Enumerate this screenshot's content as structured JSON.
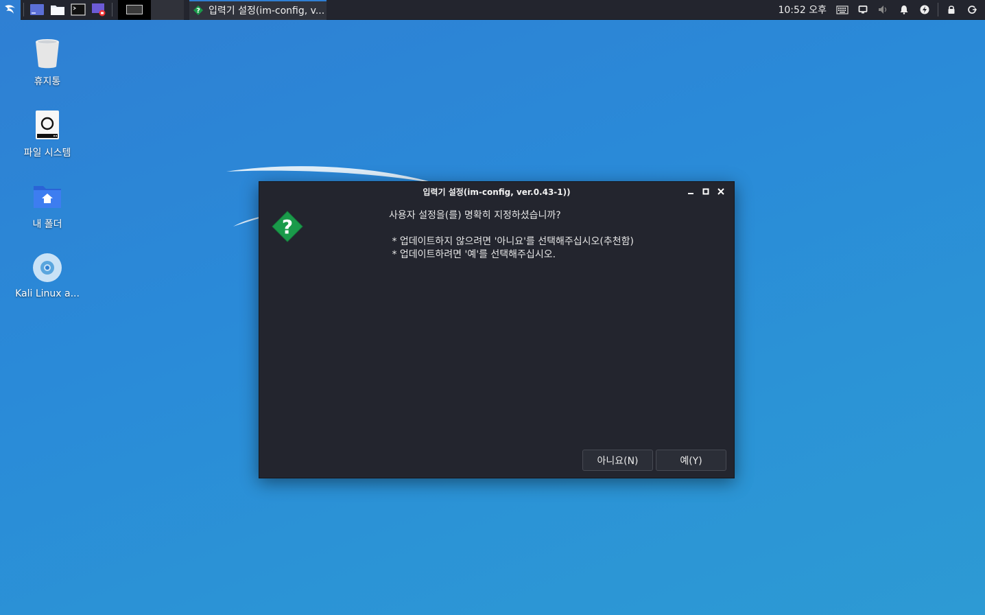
{
  "panel": {
    "task_label": "입력기 설정(im-config, v...",
    "clock": "10:52 오후"
  },
  "desktop": {
    "icons": [
      {
        "label": "휴지통",
        "icon": "trash-icon"
      },
      {
        "label": "파일 시스템",
        "icon": "drive-icon"
      },
      {
        "label": "내 폴더",
        "icon": "home-folder-icon"
      },
      {
        "label": "Kali Linux a...",
        "icon": "disc-icon"
      }
    ]
  },
  "dialog": {
    "title": "입력기 설정(im-config, ver.0.43-1))",
    "message": {
      "question": "사용자 설정을(를) 명확히 지정하셨습니까?",
      "blank": "",
      "bullet_no": " * 업데이트하지 않으려면 '아니요'를 선택해주십시오(추천함)",
      "bullet_yes": " * 업데이트하려면 '예'를 선택해주십시오."
    },
    "buttons": {
      "no": "아니요(N)",
      "yes": "예(Y)"
    }
  },
  "colors": {
    "panel_bg": "#23252e",
    "dialog_bg": "#23252e",
    "accent": "#2f7fd3",
    "question_green": "#1a9a4a"
  }
}
